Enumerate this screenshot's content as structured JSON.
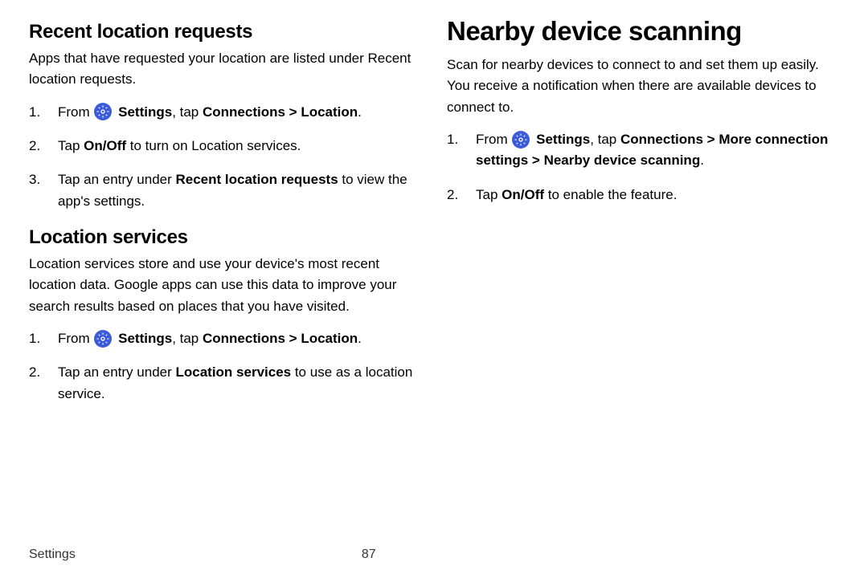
{
  "left": {
    "section1": {
      "heading": "Recent location requests",
      "body": "Apps that have requested your location are listed under Recent location requests.",
      "steps": {
        "s1_pre": "From ",
        "s1_settings": "Settings",
        "s1_mid": ", tap ",
        "s1_connections": "Connections",
        "s1_chevron": " > ",
        "s1_location": "Location",
        "s1_end": ".",
        "s2_pre": "Tap ",
        "s2_onoff": "On/Off",
        "s2_post": " to turn on Location services.",
        "s3_pre": "Tap an entry under ",
        "s3_bold": "Recent location requests",
        "s3_post": " to view the app's settings."
      }
    },
    "section2": {
      "heading": "Location services",
      "body": "Location services store and use your device's most recent location data. Google apps can use this data to improve your search results based on places that you have visited.",
      "steps": {
        "s1_pre": "From ",
        "s1_settings": "Settings",
        "s1_mid": ", tap ",
        "s1_connections": "Connections",
        "s1_chevron": " > ",
        "s1_location": "Location",
        "s1_end": ".",
        "s2_pre": "Tap an entry under ",
        "s2_bold": "Location services",
        "s2_post": " to use as a location service."
      }
    }
  },
  "right": {
    "heading": "Nearby device scanning",
    "body": "Scan for nearby devices to connect to and set them up easily. You receive a notification when there are available devices to connect to.",
    "steps": {
      "s1_pre": "From ",
      "s1_settings": "Settings",
      "s1_mid": ", tap ",
      "s1_connections": "Connections",
      "s1_chev1": " > ",
      "s1_more": "More connection settings",
      "s1_chev2": " > ",
      "s1_nearby": "Nearby device scanning",
      "s1_end": ".",
      "s2_pre": "Tap ",
      "s2_onoff": "On/Off",
      "s2_post": " to enable the feature."
    }
  },
  "footer": {
    "label": "Settings",
    "page": "87"
  }
}
